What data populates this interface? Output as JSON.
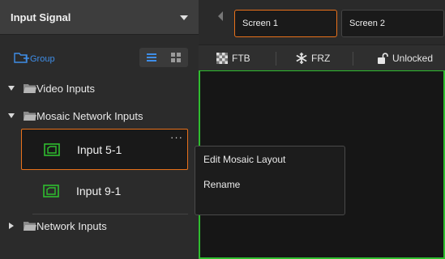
{
  "panel": {
    "title": "Input Signal",
    "group_label": "Group"
  },
  "tree": {
    "video_inputs": "Video Inputs",
    "mosaic_inputs": "Mosaic Network Inputs",
    "network_inputs": "Network Inputs",
    "items": [
      {
        "label": "Input 5-1",
        "selected": true
      },
      {
        "label": "Input 9-1",
        "selected": false
      }
    ],
    "more_label": "···"
  },
  "screens": {
    "tabs": [
      "Screen 1",
      "Screen 2"
    ],
    "active_index": 0
  },
  "actions": {
    "ftb": "FTB",
    "frz": "FRZ",
    "lock": "Unlocked"
  },
  "context_menu": {
    "items": [
      "Edit Mosaic Layout",
      "Rename"
    ]
  },
  "colors": {
    "accent_orange": "#e8711b",
    "accent_green": "#2fbd2f",
    "link_blue": "#3f8ee8"
  },
  "icons": {
    "dropdown": "chevron-down-icon",
    "group": "group-folder-icon",
    "list_view": "list-view-icon",
    "grid_view": "grid-view-icon",
    "expand": "triangle-down-icon",
    "collapse": "triangle-right-icon",
    "folder": "folder-icon",
    "input": "input-source-icon",
    "ftb": "checker-icon",
    "frz": "snowflake-icon",
    "lock": "unlock-icon",
    "prev": "chevron-left-icon"
  }
}
